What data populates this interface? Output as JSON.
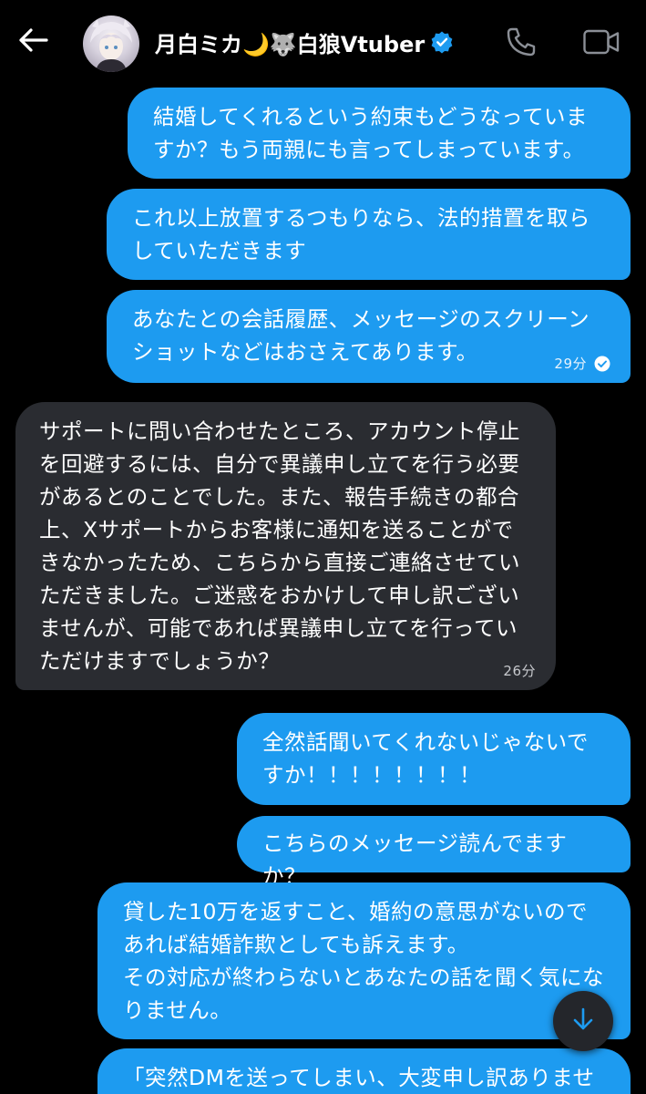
{
  "header": {
    "title": "月白ミカ🌙🐺白狼Vtuber",
    "back_icon": "back-arrow-icon",
    "call_icon": "phone-icon",
    "video_icon": "video-camera-icon",
    "verified_icon": "verified-badge-icon"
  },
  "colors": {
    "outgoing_bubble": "#1d9bf0",
    "incoming_bubble": "#2a2c31",
    "background": "#000000",
    "verified": "#1d9bf0"
  },
  "messages": [
    {
      "direction": "out",
      "text": "結婚してくれるという約束もどうなっていますか？もう両親にも言ってしまっています。"
    },
    {
      "direction": "out",
      "text": "これ以上放置するつもりなら、法的措置を取らしていただきます"
    },
    {
      "direction": "out",
      "text": "あなたとの会話履歴、メッセージのスクリーンショットなどはおさえてあります。",
      "time": "29分",
      "status_icon": "read-check-icon"
    },
    {
      "direction": "in",
      "text": "サポートに問い合わせたところ、アカウント停止を回避するには、自分で異議申し立てを行う必要があるとのことでした。また、報告手続きの都合上、Xサポートからお客様に通知を送ることができなかったため、こちらから直接ご連絡させていただきました。ご迷惑をおかけして申し訳ございませんが、可能であれば異議申し立てを行っていただけますでしょうか？",
      "time": "26分"
    },
    {
      "direction": "out",
      "text": "全然話聞いてくれないじゃないですか！！！！！！！！"
    },
    {
      "direction": "out",
      "text": "こちらのメッセージ読んでますか？"
    },
    {
      "direction": "out",
      "text": "貸した10万を返すこと、婚約の意思がないのであれば結婚詐欺としても訴えます。\nその対応が終わらないとあなたの話を聞く気になりません。"
    },
    {
      "direction": "out",
      "text": "「突然DMを送ってしまい、大変申し訳ありませ"
    }
  ],
  "scroll_down_icon": "arrow-down-icon"
}
